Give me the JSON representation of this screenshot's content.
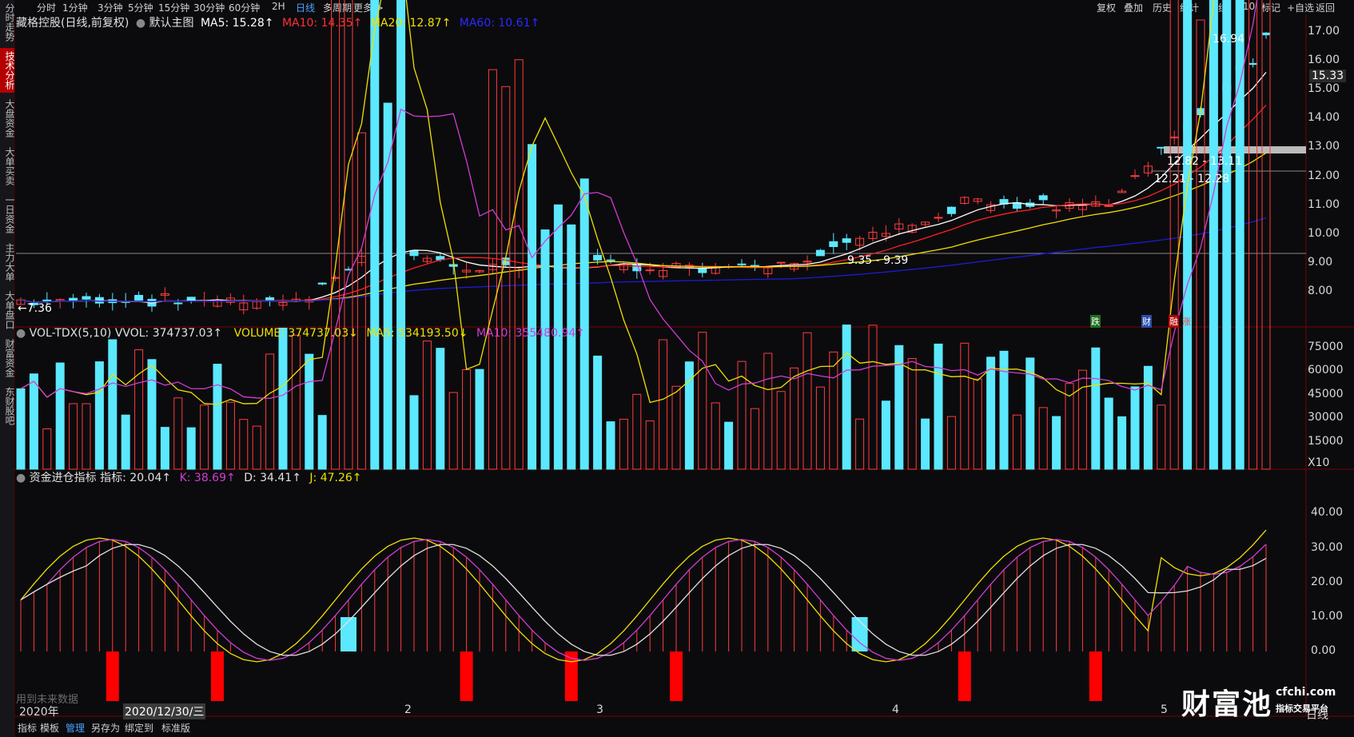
{
  "left_tabs": [
    {
      "label": "分时走势",
      "active": false
    },
    {
      "label": "技术分析",
      "active": true
    },
    {
      "label": "大盘资金",
      "active": false
    },
    {
      "label": "大单买卖",
      "active": false
    },
    {
      "label": "一日资金",
      "active": false
    },
    {
      "label": "主力大单",
      "active": false
    },
    {
      "label": "大单盘口",
      "active": false
    },
    {
      "label": "财富资金",
      "active": false
    },
    {
      "label": "东财股吧",
      "active": false
    }
  ],
  "periods": [
    "分时",
    "1分钟",
    "3分钟",
    "5分钟",
    "15分钟",
    "30分钟",
    "60分钟",
    "2H",
    "日线",
    "多周期",
    "更多 >"
  ],
  "active_period": "日线",
  "tools": [
    "复权",
    "叠加",
    "历史",
    "统计",
    "画线",
    "F10",
    "标记",
    "+自选",
    "返回"
  ],
  "main_legend": {
    "stock": "藏格控股(日线,前复权)",
    "template": "默认主图",
    "ma5": "MA5: 15.28↑",
    "ma10": "MA10: 14.35↑",
    "ma20": "MA20: 12.87↑",
    "ma60": "MA60: 10.61↑"
  },
  "vol_legend": {
    "name": "VOL-TDX(5,10)",
    "vvol": "VVOL: 374737.03↑",
    "volume": "VOLUME: 374737.03↓",
    "ma5": "MA5: 534193.50↓",
    "ma10": "MA10: 355480.94↑"
  },
  "ind_legend": {
    "name": "资金进仓指标",
    "val": "指标: 20.04↑",
    "k": "K: 38.69↑",
    "d": "D: 34.41↑",
    "j": "J: 47.26↑"
  },
  "annotations": {
    "high": "16.94",
    "low": "←7.36",
    "current": "15.33",
    "gap1": "12.82 - 13.11",
    "gap2": "12.21 - 12.28",
    "gap3": "9.35 - 9.39",
    "badges": [
      "跌",
      "财",
      "融",
      "涨"
    ],
    "future": "用到未来数据"
  },
  "price_axis": [
    "17.00",
    "16.00",
    "15.00",
    "14.00",
    "13.00",
    "12.00",
    "11.00",
    "10.00",
    "9.00",
    "8.00"
  ],
  "vol_axis": [
    "75000",
    "60000",
    "45000",
    "30000",
    "15000",
    "X10"
  ],
  "ind_axis": [
    "40.00",
    "30.00",
    "20.00",
    "10.00",
    "0.00"
  ],
  "x_labels": {
    "year": "2020年",
    "cursor": "2020/12/30/三",
    "months": [
      "2",
      "3",
      "4",
      "5"
    ]
  },
  "bottom_tabs": [
    "指标",
    "模板",
    "管理",
    "另存为",
    "绑定到",
    "标准版"
  ],
  "bottom_active": "管理",
  "bottom_right": "日线",
  "watermark": {
    "brand": "财富池",
    "domain": "cfchi.com",
    "slogan": "指标交易平台"
  },
  "colors": {
    "up": "#ff3c3c",
    "down": "#5ce8ff",
    "ma5": "#ffffff",
    "ma10": "#ff2020",
    "ma20": "#f0e000",
    "ma60": "#1c1cd8",
    "vma10": "#d23cd2"
  }
}
